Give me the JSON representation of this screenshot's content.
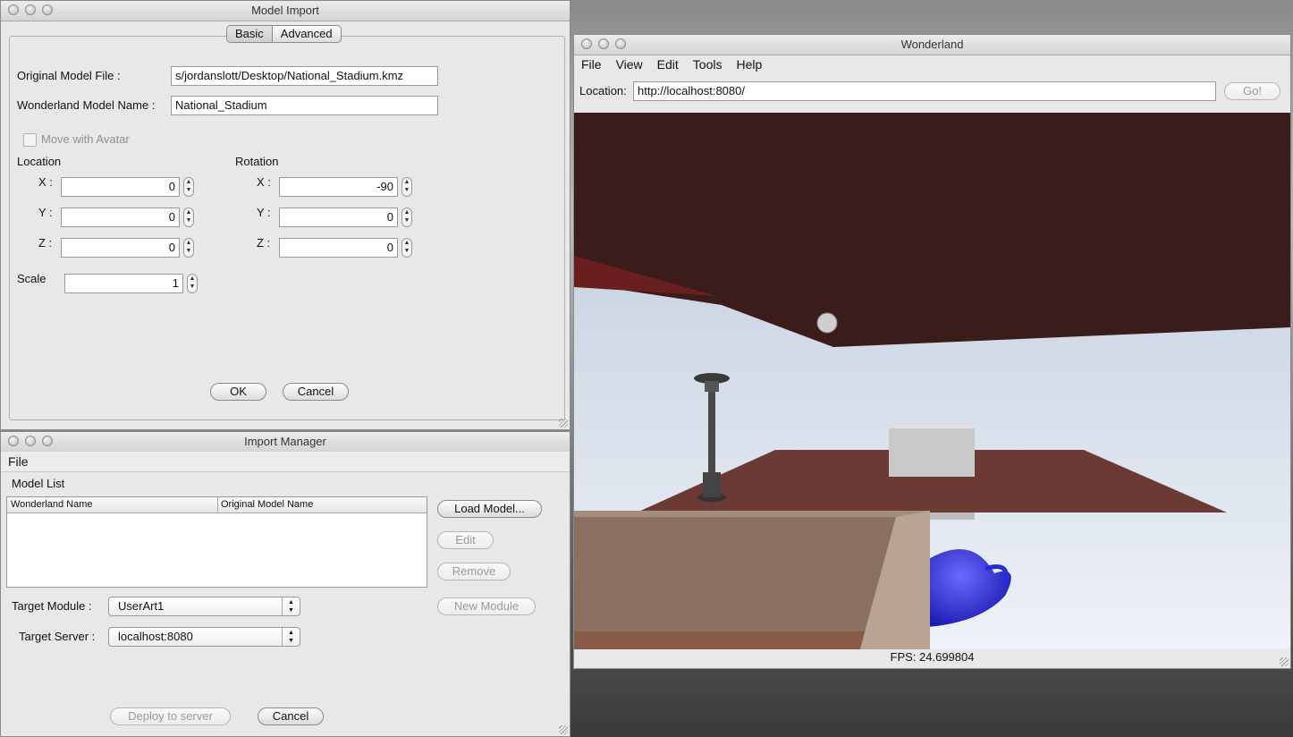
{
  "model_import": {
    "title": "Model Import",
    "tabs": [
      "Basic",
      "Advanced"
    ],
    "original_model_file_label": "Original Model File :",
    "original_model_file_value": "s/jordanslott/Desktop/National_Stadium.kmz",
    "wonderland_model_name_label": "Wonderland Model Name :",
    "wonderland_model_name_value": "National_Stadium",
    "move_with_avatar_label": "Move with Avatar",
    "location_label": "Location",
    "rotation_label": "Rotation",
    "x_label": "X :",
    "y_label": "Y :",
    "z_label": "Z :",
    "location": {
      "x": "0",
      "y": "0",
      "z": "0"
    },
    "rotation": {
      "x": "-90",
      "y": "0",
      "z": "0"
    },
    "scale_label": "Scale",
    "scale_value": "1",
    "ok_label": "OK",
    "cancel_label": "Cancel"
  },
  "import_manager": {
    "title": "Import Manager",
    "menu_file": "File",
    "model_list_label": "Model List",
    "columns": [
      "Wonderland Name",
      "Original Model Name"
    ],
    "load_model_label": "Load Model...",
    "edit_label": "Edit",
    "remove_label": "Remove",
    "new_module_label": "New Module",
    "target_module_label": "Target Module :",
    "target_module_value": "UserArt1",
    "target_server_label": "Target Server :",
    "target_server_value": "localhost:8080",
    "deploy_label": "Deploy to server",
    "cancel_label": "Cancel"
  },
  "wonderland": {
    "title": "Wonderland",
    "menu": [
      "File",
      "View",
      "Edit",
      "Tools",
      "Help"
    ],
    "location_label": "Location:",
    "location_value": "http://localhost:8080/",
    "go_label": "Go!",
    "fps": "FPS: 24.699804"
  },
  "colors": {
    "sky": "#e9eef6",
    "ceiling": "#3a1c1a",
    "floor": "#6b3a35",
    "teapot": "#2a2ad8"
  }
}
